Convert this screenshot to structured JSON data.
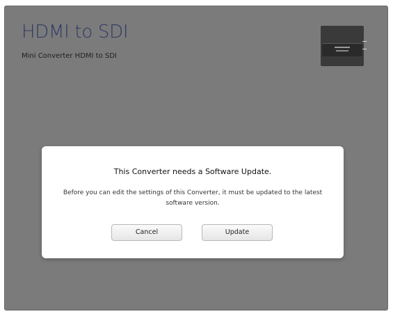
{
  "window": {
    "title": "HDMI to SDI",
    "subtitle": "Mini Converter HDMI to SDI"
  },
  "device_image": {
    "icon": "mini-converter-device-icon"
  },
  "dialog": {
    "heading": "This Converter needs a Software Update.",
    "body": "Before you can edit the settings of this Converter, it must be updated to the latest software version.",
    "cancel_label": "Cancel",
    "update_label": "Update"
  },
  "colors": {
    "window_background": "#7b7b7b",
    "title": "#2e3a66",
    "dialog_background": "#ffffff"
  }
}
